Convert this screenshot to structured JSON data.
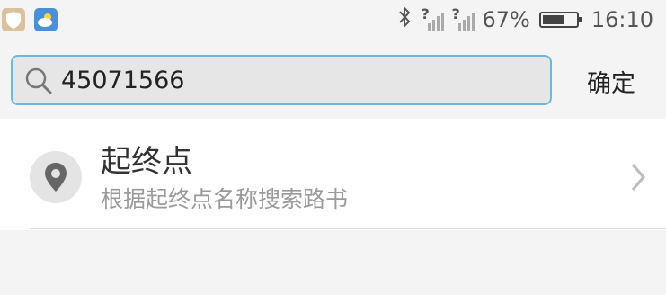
{
  "status_bar": {
    "icons": [
      "shield-icon",
      "weather-icon",
      "bluetooth-icon",
      "signal-icon",
      "signal-icon",
      "battery-icon"
    ],
    "signal_unknown_mark": "?",
    "battery_percent": "67%",
    "battery_level": 0.67,
    "time": "16:10"
  },
  "search": {
    "value": "45071566",
    "confirm_label": "确定",
    "accent_color": "#6fb7e3"
  },
  "result": {
    "title": "起终点",
    "subtitle": "根据起终点名称搜索路书",
    "icon": "location-pin-icon"
  }
}
